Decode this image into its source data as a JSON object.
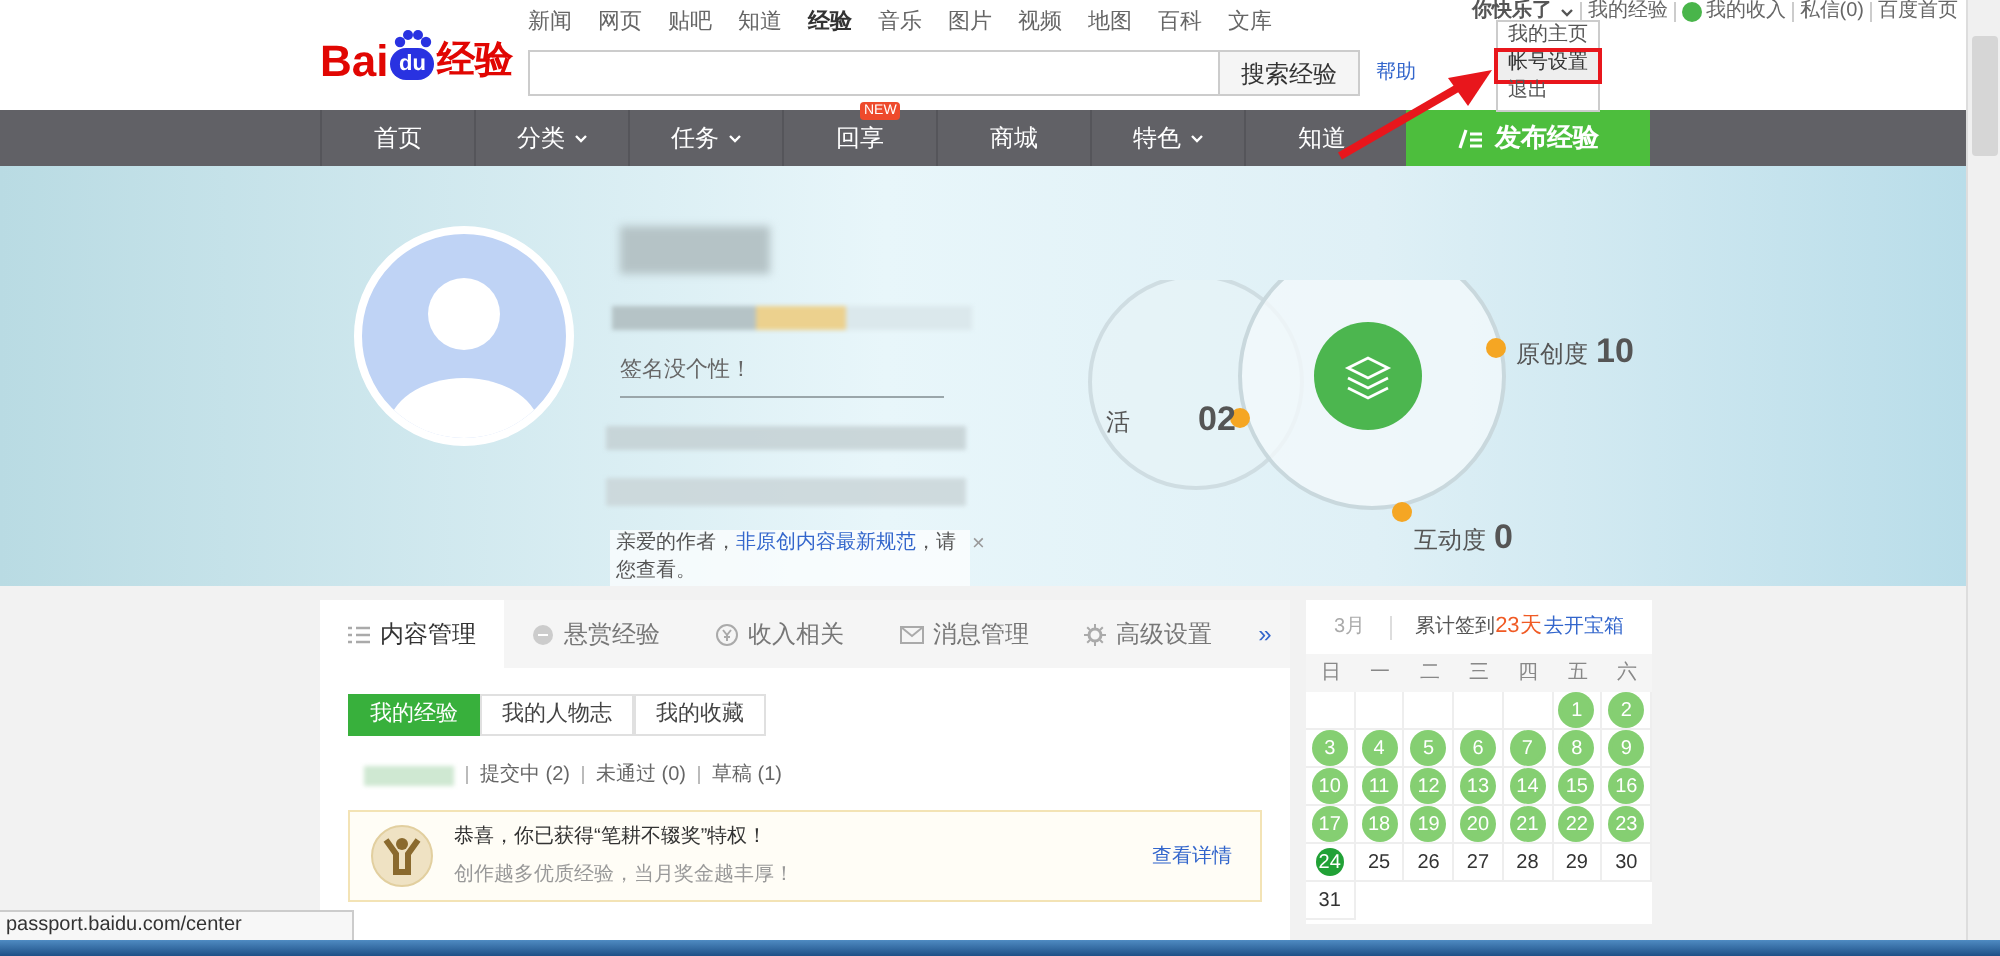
{
  "logo": {
    "left": "Bai",
    "paw": "du",
    "right": "经验"
  },
  "top_links": [
    {
      "label": "新闻",
      "selected": false
    },
    {
      "label": "网页",
      "selected": false
    },
    {
      "label": "贴吧",
      "selected": false
    },
    {
      "label": "知道",
      "selected": false
    },
    {
      "label": "经验",
      "selected": true
    },
    {
      "label": "音乐",
      "selected": false
    },
    {
      "label": "图片",
      "selected": false
    },
    {
      "label": "视频",
      "selected": false
    },
    {
      "label": "地图",
      "selected": false
    },
    {
      "label": "百科",
      "selected": false
    },
    {
      "label": "文库",
      "selected": false
    }
  ],
  "search": {
    "button": "搜索经验",
    "help": "帮助"
  },
  "user": {
    "name": "你快乐了",
    "links": [
      {
        "label": "我的经验",
        "kind": "plain"
      },
      {
        "label": "我的收入",
        "kind": "money"
      },
      {
        "label": "私信(0)",
        "kind": "plain"
      },
      {
        "label": "百度首页",
        "kind": "plain"
      }
    ]
  },
  "user_menu": [
    {
      "label": "我的主页",
      "selected": false,
      "annotated": false
    },
    {
      "label": "帐号设置",
      "selected": true,
      "annotated": true
    },
    {
      "label": "退出",
      "selected": false,
      "annotated": false
    }
  ],
  "nav": {
    "items": [
      {
        "label": "首页",
        "dropdown": false
      },
      {
        "label": "分类",
        "dropdown": true
      },
      {
        "label": "任务",
        "dropdown": true
      },
      {
        "label": "回享",
        "dropdown": false,
        "badge": "NEW"
      },
      {
        "label": "商城",
        "dropdown": false
      },
      {
        "label": "特色",
        "dropdown": true
      },
      {
        "label": "知道",
        "dropdown": false
      }
    ],
    "publish": "发布经验"
  },
  "profile": {
    "signature": "签名没个性！",
    "stats": [
      {
        "kind": "originality",
        "label": "原创度",
        "value": "10"
      },
      {
        "kind": "interaction",
        "label": "互动度",
        "value": "0"
      },
      {
        "kind": "activity",
        "label": "活",
        "value": "02"
      }
    ],
    "notice": {
      "text": "亲爱的作者，",
      "link": "非原创内容最新规范",
      "tail": "，请您查看。",
      "close": "×"
    }
  },
  "tabs": [
    {
      "label": "内容管理",
      "selected": true
    },
    {
      "label": "悬赏经验",
      "selected": false
    },
    {
      "label": "收入相关",
      "selected": false
    },
    {
      "label": "消息管理",
      "selected": false
    },
    {
      "label": "高级设置",
      "selected": false
    }
  ],
  "tabs_more": "»",
  "subtabs": [
    {
      "label": "我的经验",
      "selected": true
    },
    {
      "label": "我的人物志",
      "selected": false
    },
    {
      "label": "我的收藏",
      "selected": false
    }
  ],
  "filters": [
    "提交中 (2)",
    "未通过 (0)",
    "草稿 (1)"
  ],
  "award": {
    "title": "恭喜，你已获得“笔耕不辍奖”特权！",
    "subtitle": "创作越多优质经验，当月奖金越丰厚！",
    "link": "查看详情"
  },
  "calendar": {
    "month": "3月",
    "summary": "累计签到",
    "count": "23天",
    "link": "去开宝箱",
    "weekdays": [
      "日",
      "一",
      "二",
      "三",
      "四",
      "五",
      "六"
    ],
    "weeks": [
      [
        {
          "kind": "blank"
        },
        {
          "kind": "blank"
        },
        {
          "kind": "blank"
        },
        {
          "kind": "blank"
        },
        {
          "kind": "blank"
        },
        {
          "kind": "day",
          "day": "1",
          "signed": true,
          "today": false
        },
        {
          "kind": "day",
          "day": "2",
          "signed": true,
          "today": false
        }
      ],
      [
        {
          "kind": "day",
          "day": "3",
          "signed": true,
          "today": false
        },
        {
          "kind": "day",
          "day": "4",
          "signed": true,
          "today": false
        },
        {
          "kind": "day",
          "day": "5",
          "signed": true,
          "today": false
        },
        {
          "kind": "day",
          "day": "6",
          "signed": true,
          "today": false
        },
        {
          "kind": "day",
          "day": "7",
          "signed": true,
          "today": false
        },
        {
          "kind": "day",
          "day": "8",
          "signed": true,
          "today": false
        },
        {
          "kind": "day",
          "day": "9",
          "signed": true,
          "today": false
        }
      ],
      [
        {
          "kind": "day",
          "day": "10",
          "signed": true,
          "today": false
        },
        {
          "kind": "day",
          "day": "11",
          "signed": true,
          "today": false
        },
        {
          "kind": "day",
          "day": "12",
          "signed": true,
          "today": false
        },
        {
          "kind": "day",
          "day": "13",
          "signed": true,
          "today": false
        },
        {
          "kind": "day",
          "day": "14",
          "signed": true,
          "today": false
        },
        {
          "kind": "day",
          "day": "15",
          "signed": true,
          "today": false
        },
        {
          "kind": "day",
          "day": "16",
          "signed": true,
          "today": false
        }
      ],
      [
        {
          "kind": "day",
          "day": "17",
          "signed": true,
          "today": false
        },
        {
          "kind": "day",
          "day": "18",
          "signed": true,
          "today": false
        },
        {
          "kind": "day",
          "day": "19",
          "signed": true,
          "today": false
        },
        {
          "kind": "day",
          "day": "20",
          "signed": true,
          "today": false
        },
        {
          "kind": "day",
          "day": "21",
          "signed": true,
          "today": false
        },
        {
          "kind": "day",
          "day": "22",
          "signed": true,
          "today": false
        },
        {
          "kind": "day",
          "day": "23",
          "signed": true,
          "today": false
        }
      ],
      [
        {
          "kind": "day",
          "day": "24",
          "signed": false,
          "today": true
        },
        {
          "kind": "day",
          "day": "25",
          "signed": false,
          "today": false
        },
        {
          "kind": "day",
          "day": "26",
          "signed": false,
          "today": false
        },
        {
          "kind": "day",
          "day": "27",
          "signed": false,
          "today": false
        },
        {
          "kind": "day",
          "day": "28",
          "signed": false,
          "today": false
        },
        {
          "kind": "day",
          "day": "29",
          "signed": false,
          "today": false
        },
        {
          "kind": "day",
          "day": "30",
          "signed": false,
          "today": false
        }
      ],
      [
        {
          "kind": "day",
          "day": "31",
          "signed": false,
          "today": false
        }
      ]
    ]
  },
  "status_bar": "passport.baidu.com/center"
}
